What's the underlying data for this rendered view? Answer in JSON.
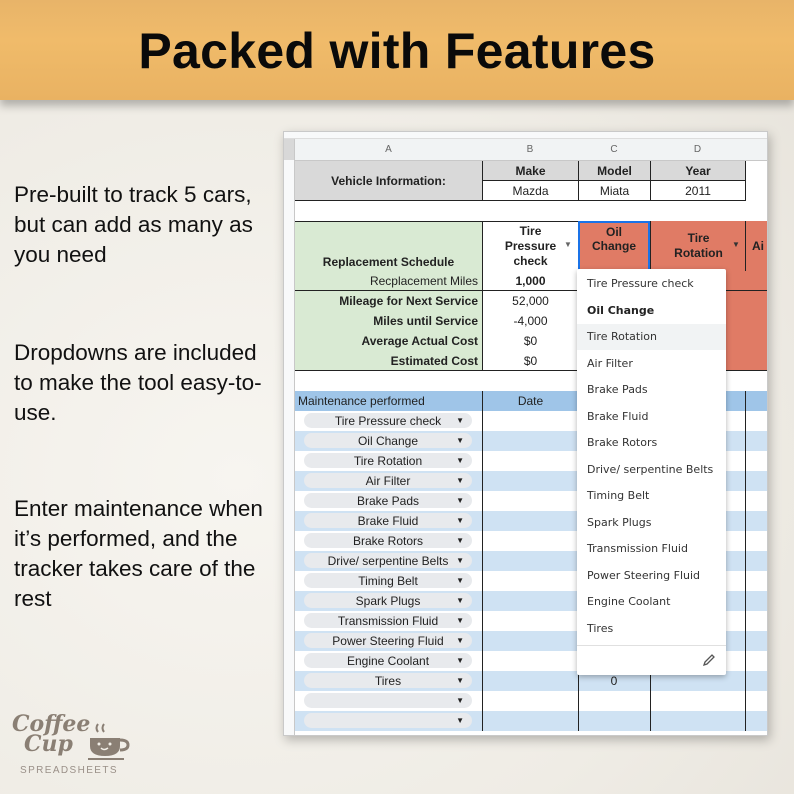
{
  "banner": {
    "title": "Packed with Features"
  },
  "features": [
    "Pre-built to track 5 cars, but can add as many as you need",
    "Dropdowns are included to make the tool easy-to-use.",
    "Enter maintenance when it’s performed, and the tracker takes care of the rest"
  ],
  "logo": {
    "line1": "Coffee",
    "line2": "Cup",
    "sub": "SPREADSHEETS",
    "icon": "coffee-cup-icon"
  },
  "sheet": {
    "columns": [
      "A",
      "B",
      "C",
      "D"
    ],
    "vehicle": {
      "label": "Vehicle Information:",
      "headers": [
        "Make",
        "Model",
        "Year"
      ],
      "values": [
        "Mazda",
        "Miata",
        "2011"
      ]
    },
    "schedule": {
      "title": "Replacement Schedule",
      "miles_label": "Recplacement Miles",
      "service_headers": [
        "Tire Pressure check",
        "Oil Change",
        "Tire Rotation",
        "Ai"
      ],
      "editing_cell": "Oil Change",
      "replacement_miles": "1,000",
      "rows": [
        {
          "label": "Mileage for Next Service",
          "value": "52,000"
        },
        {
          "label": "Miles until Service",
          "value": "-4,000"
        },
        {
          "label": "Average Actual Cost",
          "value": "$0"
        },
        {
          "label": "Estimated Cost",
          "value": "$0"
        }
      ]
    },
    "log": {
      "headers": [
        "Maintenance performed",
        "Date"
      ],
      "entries": [
        "Tire Pressure check",
        "Oil Change",
        "Tire Rotation",
        "Air Filter",
        "Brake Pads",
        "Brake Fluid",
        "Brake Rotors",
        "Drive/ serpentine Belts",
        "Timing Belt",
        "Spark Plugs",
        "Transmission Fluid",
        "Power Steering Fluid",
        "Engine Coolant",
        "Tires",
        "",
        ""
      ],
      "col_c_value": "0"
    },
    "dropdown": {
      "options": [
        "Tire Pressure check",
        "Oil Change",
        "Tire Rotation",
        "Air Filter",
        "Brake Pads",
        "Brake Fluid",
        "Brake Rotors",
        "Drive/ serpentine Belts",
        "Timing Belt",
        "Spark Plugs",
        "Transmission Fluid",
        "Power Steering Fluid",
        "Engine Coolant",
        "Tires"
      ],
      "selected": "Oil Change",
      "hovered": "Tire Rotation",
      "edit_icon": "pencil-icon"
    }
  }
}
